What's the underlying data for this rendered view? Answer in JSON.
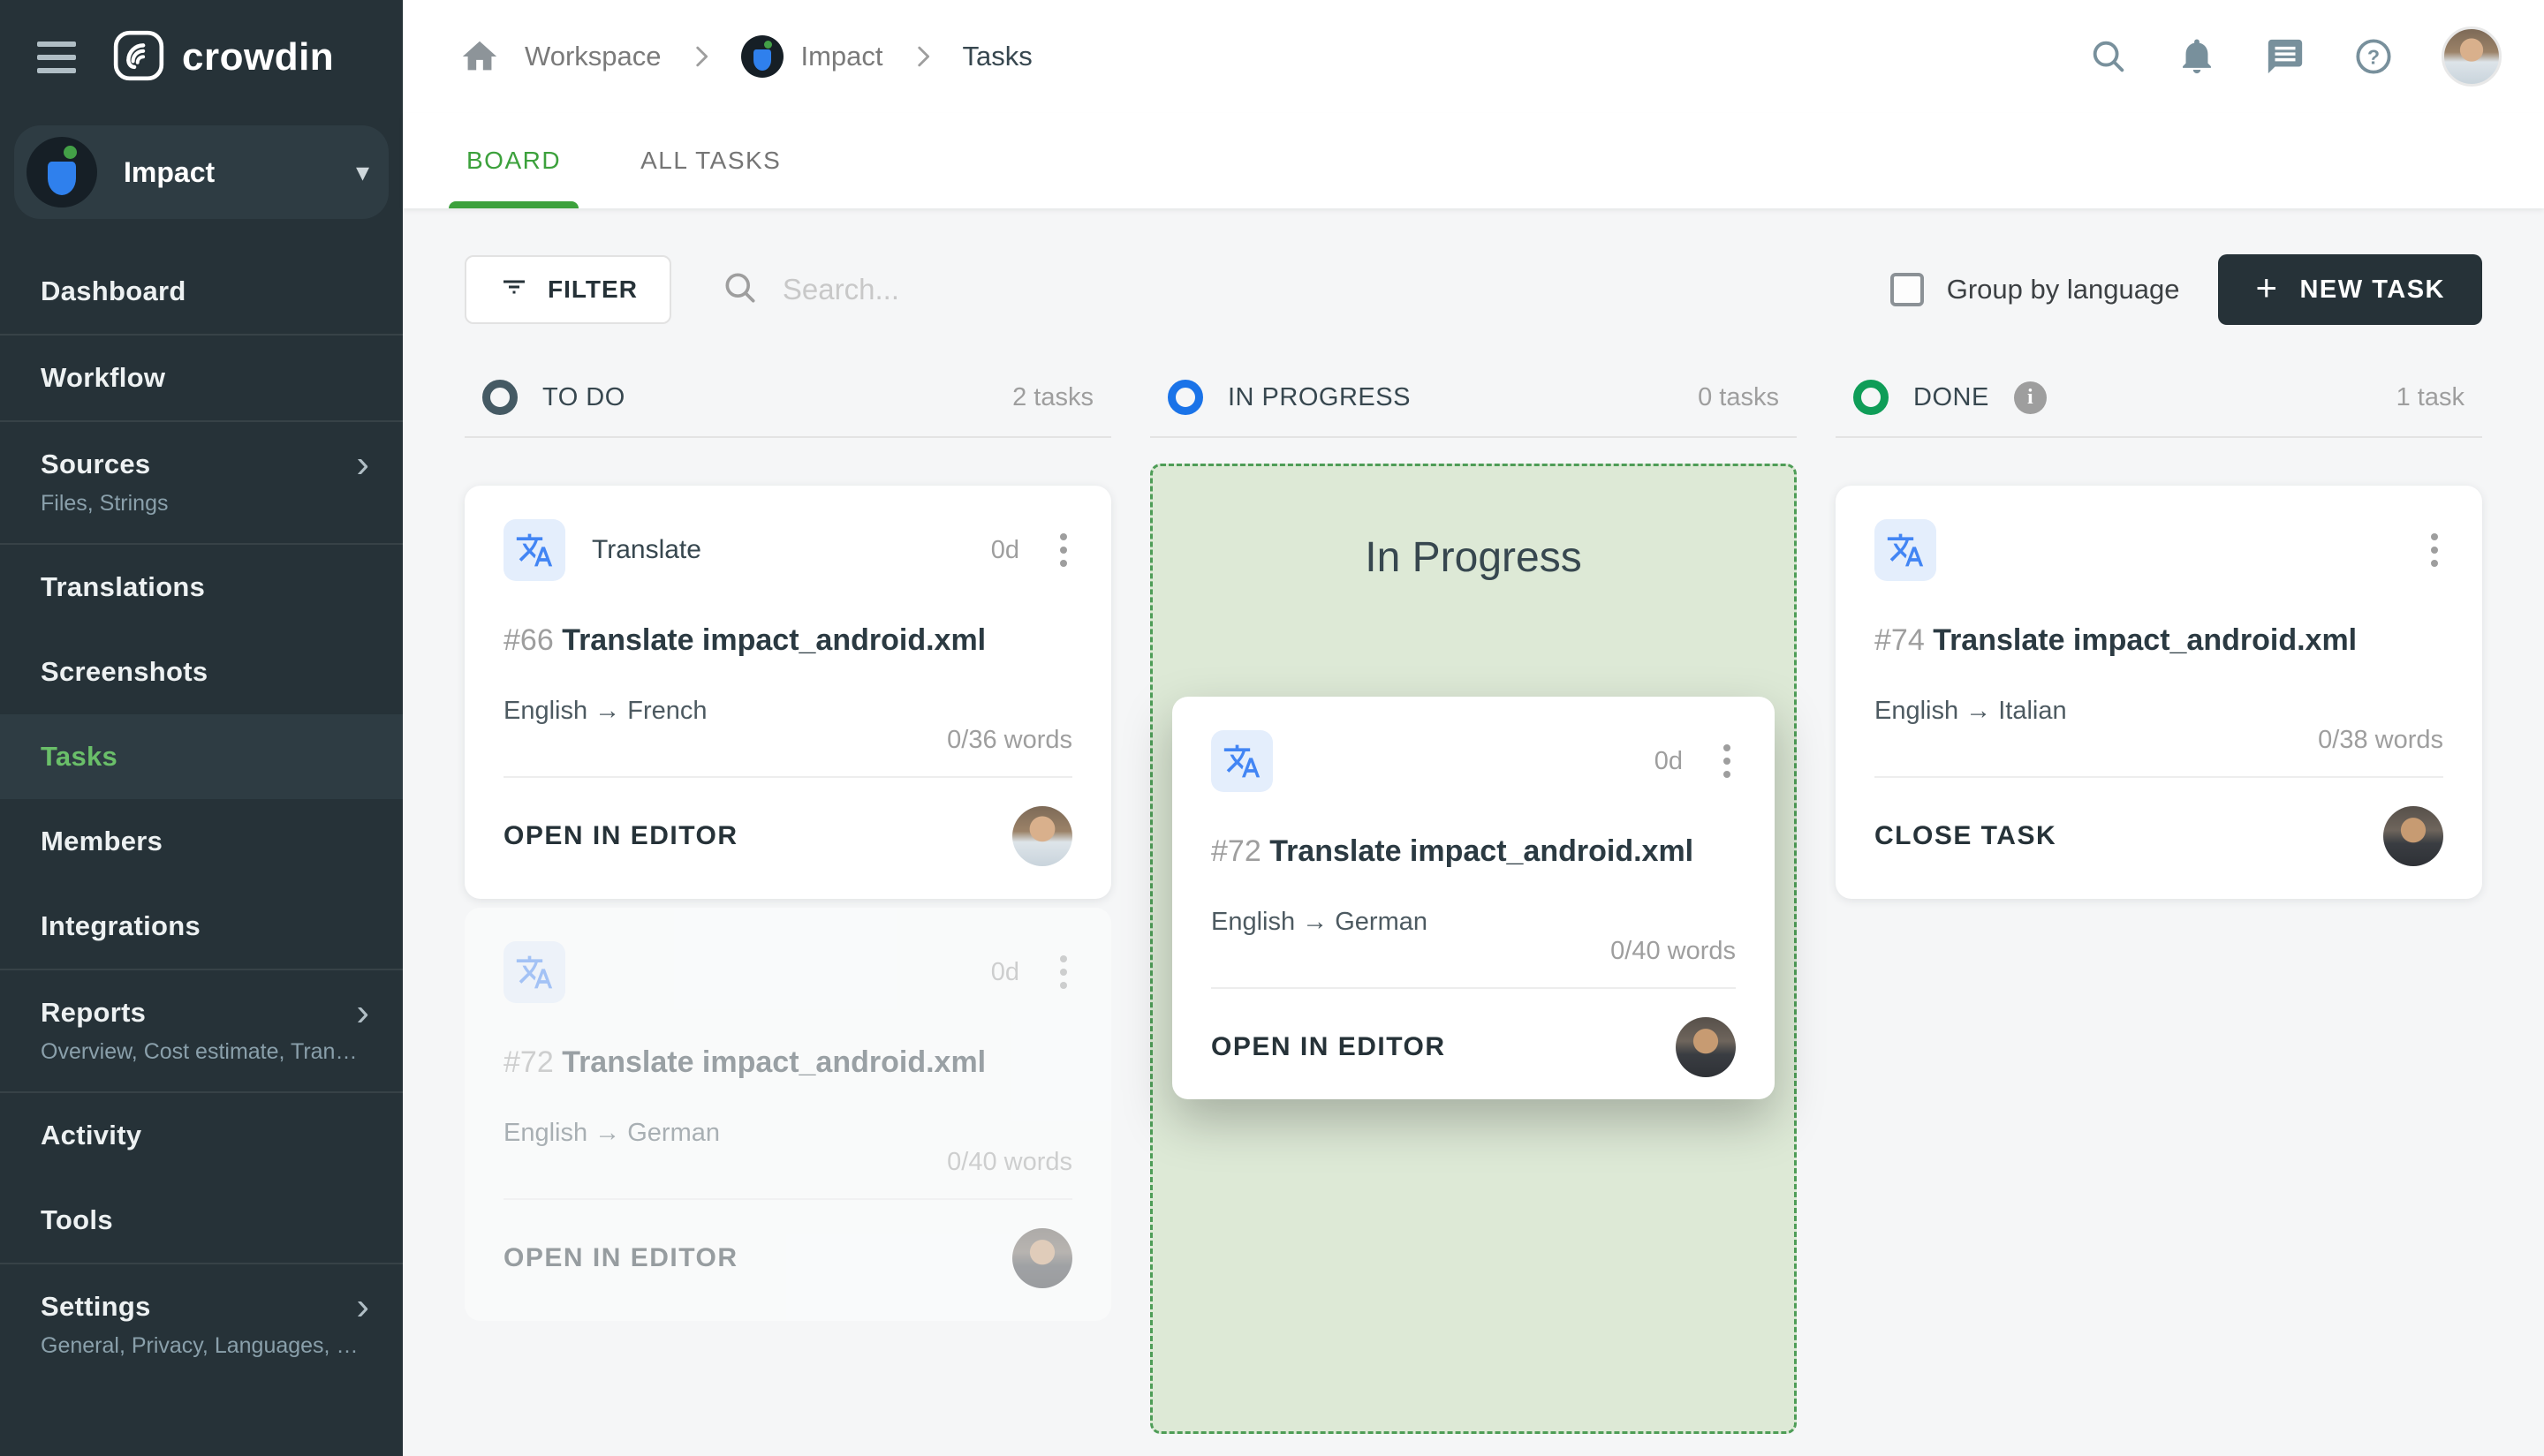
{
  "sidebar": {
    "brand": "crowdin",
    "project": {
      "name": "Impact"
    },
    "items": [
      {
        "label": "Dashboard"
      },
      {
        "label": "Workflow"
      },
      {
        "label": "Sources",
        "sub": "Files, Strings"
      },
      {
        "label": "Translations"
      },
      {
        "label": "Screenshots"
      },
      {
        "label": "Tasks"
      },
      {
        "label": "Members"
      },
      {
        "label": "Integrations"
      },
      {
        "label": "Reports",
        "sub": "Overview, Cost estimate, Transl..."
      },
      {
        "label": "Activity"
      },
      {
        "label": "Tools"
      },
      {
        "label": "Settings",
        "sub": "General, Privacy, Languages, Q..."
      }
    ]
  },
  "header": {
    "breadcrumb": {
      "workspace": "Workspace",
      "project": "Impact",
      "current": "Tasks"
    },
    "icons": [
      "search",
      "notifications",
      "messages",
      "help",
      "user-avatar"
    ]
  },
  "tabs": [
    {
      "label": "BOARD",
      "active": true
    },
    {
      "label": "ALL TASKS",
      "active": false
    }
  ],
  "toolbar": {
    "filter_label": "FILTER",
    "search_placeholder": "Search...",
    "group_by_label": "Group by language",
    "new_task_label": "NEW TASK",
    "new_task_plus": "+"
  },
  "board": {
    "columns": [
      {
        "title": "TO DO",
        "count_label": "2 tasks",
        "status_color": "#455a64"
      },
      {
        "title": "IN PROGRESS",
        "count_label": "0 tasks",
        "status_color": "#1a73e8",
        "dropzone_label": "In Progress"
      },
      {
        "title": "DONE",
        "count_label": "1 task",
        "status_color": "#0f9d58",
        "has_info": true,
        "info_glyph": "i"
      }
    ],
    "cards": [
      {
        "id": "#66",
        "type_label": "Translate",
        "title": "Translate impact_android.xml",
        "langs": "English → French",
        "due": "0d",
        "words": "0/36 words",
        "action": "OPEN IN EDITOR",
        "state": "todo"
      },
      {
        "id": "#72",
        "title": "Translate impact_android.xml",
        "langs": "English → German",
        "due": "0d",
        "words": "0/40 words",
        "action": "OPEN IN EDITOR",
        "state": "ghost"
      },
      {
        "id": "#72",
        "title": "Translate impact_android.xml",
        "langs": "English → German",
        "due": "0d",
        "words": "0/40 words",
        "action": "OPEN IN EDITOR",
        "state": "dragging"
      },
      {
        "id": "#74",
        "title": "Translate impact_android.xml",
        "langs": "English → Italian",
        "words": "0/38 words",
        "action": "CLOSE TASK",
        "state": "done"
      }
    ]
  },
  "colors": {
    "sidebar_bg": "#263238",
    "accent_green": "#3ca13c",
    "active_item_green": "#6abf69",
    "status_todo": "#455a64",
    "status_in_progress": "#1a73e8",
    "status_done": "#0f9d58",
    "dropzone_bg": "#dde9d6",
    "new_task_bg": "#263238",
    "translate_icon_blue": "#4285f4"
  }
}
